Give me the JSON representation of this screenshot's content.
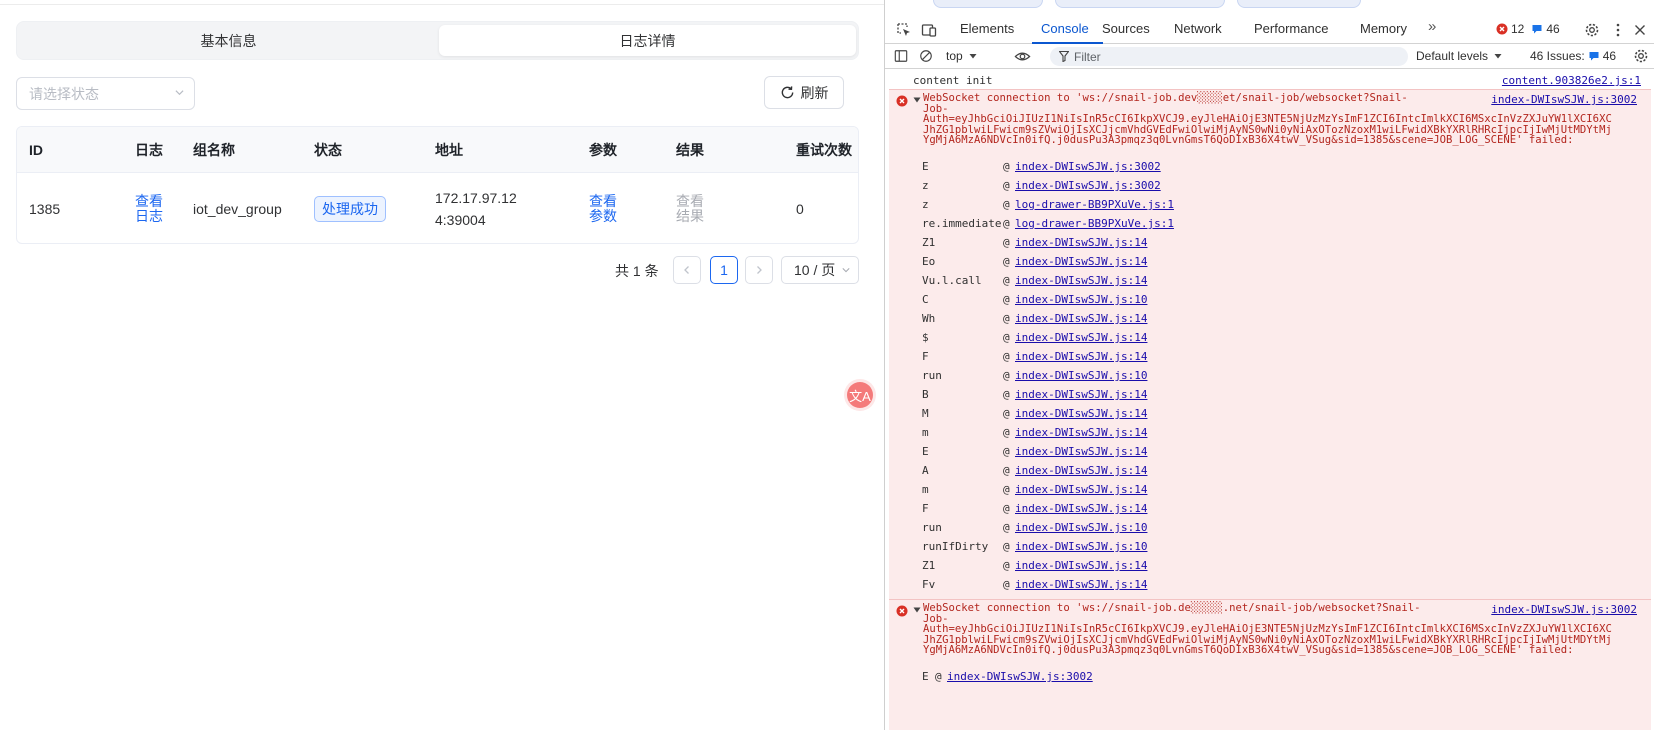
{
  "app": {
    "segments": [
      "基本信息",
      "日志详情"
    ],
    "status_placeholder": "请选择状态",
    "refresh_label": "刷新",
    "table": {
      "headers": [
        "ID",
        "日志",
        "组名称",
        "状态",
        "地址",
        "参数",
        "结果",
        "重试次数"
      ],
      "row": {
        "id": "1385",
        "log_link_1": "查看",
        "log_link_2": "日志",
        "group": "iot_dev_group",
        "status": "处理成功",
        "addr_1": "172.17.97.12",
        "addr_2": "4:39004",
        "params_1": "查看",
        "params_2": "参数",
        "result_1": "查看",
        "result_2": "结果",
        "retries": "0"
      }
    },
    "pagination": {
      "total": "共 1 条",
      "current_page": "1",
      "page_size": "10 / 页",
      "prev_icon": "chevron-left-icon",
      "next_icon": "chevron-right-icon"
    },
    "translate_badge": "文A"
  },
  "devtools": {
    "tabs": [
      "Elements",
      "Console",
      "Sources",
      "Network",
      "Performance",
      "Memory"
    ],
    "active_tab": "Console",
    "more_tabs": "»",
    "error_count": "12",
    "issue_count_top": "46",
    "context": "top",
    "filter_placeholder": "Filter",
    "levels": "Default levels",
    "issues_label": "46 Issues:",
    "issues_count": "46",
    "console": {
      "info_text": "content init",
      "info_src": "content.903826e2.js:1",
      "error1": {
        "message": "WebSocket connection to 'ws://snail-job.dev░░░░et/snail-job/websocket?Snail-\nJob-\nAuth=eyJhbGciOiJIUzI1NiIsInR5cCI6IkpXVCJ9.eyJleHAiOjE3NTE5NjUzMzYsImF1ZCI6IntcImlkXCI6MSxcInVzZXJuYW1lXCI6XC\nJhZG1pblwiLFwicm9sZVwiOjIsXCJjcmVhdGVEdFwiOlwiMjAyNS0wNi0yNiAxOTozNzoxM1wiLFwidXBkYXRlRHRcIjpcIjIwMjUtMDYtMj\nYgMjA6MzA6NDVcIn0ifQ.j0dusPu3A3pmqz3q0LvnGmsT6QoDIxB36X4twV_VSug&sid=1385&scene=JOB_LOG_SCENE' failed:",
        "src": "index-DWIswSJW.js:3002",
        "stack": [
          {
            "fn": "E",
            "link": "index-DWIswSJW.js:3002"
          },
          {
            "fn": "z",
            "link": "index-DWIswSJW.js:3002"
          },
          {
            "fn": "z",
            "link": "log-drawer-BB9PXuVe.js:1"
          },
          {
            "fn": "re.immediate",
            "link": "log-drawer-BB9PXuVe.js:1"
          },
          {
            "fn": "Z1",
            "link": "index-DWIswSJW.js:14"
          },
          {
            "fn": "Eo",
            "link": "index-DWIswSJW.js:14"
          },
          {
            "fn": "Vu.l.call",
            "link": "index-DWIswSJW.js:14"
          },
          {
            "fn": "C",
            "link": "index-DWIswSJW.js:10"
          },
          {
            "fn": "Wh",
            "link": "index-DWIswSJW.js:14"
          },
          {
            "fn": "$",
            "link": "index-DWIswSJW.js:14"
          },
          {
            "fn": "F",
            "link": "index-DWIswSJW.js:14"
          },
          {
            "fn": "run",
            "link": "index-DWIswSJW.js:10"
          },
          {
            "fn": "B",
            "link": "index-DWIswSJW.js:14"
          },
          {
            "fn": "M",
            "link": "index-DWIswSJW.js:14"
          },
          {
            "fn": "m",
            "link": "index-DWIswSJW.js:14"
          },
          {
            "fn": "E",
            "link": "index-DWIswSJW.js:14"
          },
          {
            "fn": "A",
            "link": "index-DWIswSJW.js:14"
          },
          {
            "fn": "m",
            "link": "index-DWIswSJW.js:14"
          },
          {
            "fn": "F",
            "link": "index-DWIswSJW.js:14"
          },
          {
            "fn": "run",
            "link": "index-DWIswSJW.js:10"
          },
          {
            "fn": "runIfDirty",
            "link": "index-DWIswSJW.js:10"
          },
          {
            "fn": "Z1",
            "link": "index-DWIswSJW.js:14"
          },
          {
            "fn": "Fv",
            "link": "index-DWIswSJW.js:14"
          }
        ]
      },
      "error2": {
        "message": "WebSocket connection to 'ws://snail-job.de░░░░░.net/snail-job/websocket?Snail-\nJob-\nAuth=eyJhbGciOiJIUzI1NiIsInR5cCI6IkpXVCJ9.eyJleHAiOjE3NTE5NjUzMzYsImF1ZCI6IntcImlkXCI6MSxcInVzZXJuYW1lXCI6XC\nJhZG1pblwiLFwicm9sZVwiOjIsXCJjcmVhdGVEdFwiOlwiMjAyNS0wNi0yNiAxOTozNzoxM1wiLFwidXBkYXRlRHRcIjpcIjIwMjUtMDYtMj\nYgMjA6MzA6NDVcIn0ifQ.j0dusPu3A3pmqz3q0LvnGmsT6QoDIxB36X4twV_VSug&sid=1385&scene=JOB_LOG_SCENE' failed:",
        "src": "index-DWIswSJW.js:3002",
        "stack_fn": "E",
        "stack_at": "@",
        "stack_link": "index-DWIswSJW.js:3002"
      }
    }
  },
  "colors": {
    "accent": "#1c67f0",
    "error_bg": "#fcebeb",
    "error_text": "#b3261e",
    "devtools_accent": "#0b57d0"
  }
}
